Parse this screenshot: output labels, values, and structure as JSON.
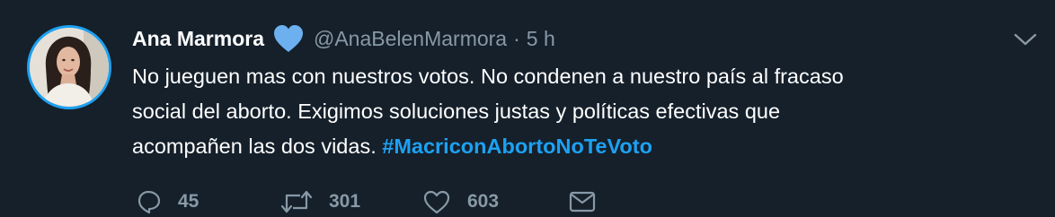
{
  "author": {
    "name": "Ana Marmora",
    "handle": "@AnaBelenMarmora",
    "separator": "·",
    "time": "5 h"
  },
  "tweet": {
    "line1": "No jueguen mas con nuestros votos. No condenen a nuestro país al fracaso",
    "line2": "social del aborto. Exigimos soluciones justas y políticas efectivas que",
    "line3": "acompañen las dos vidas.",
    "hashtag": "#MacriconAbortoNoTeVoto"
  },
  "actions": {
    "reply_count": "45",
    "retweet_count": "301",
    "like_count": "603"
  },
  "icons": {
    "verified": "heart-icon",
    "menu": "chevron-down-icon",
    "reply": "reply-icon",
    "retweet": "retweet-icon",
    "like": "heart-outline-icon",
    "dm": "envelope-icon"
  },
  "colors": {
    "background": "#15202b",
    "accent": "#1da1f2",
    "secondary_text": "#8899a6",
    "verified_heart": "#6cb0f0"
  }
}
